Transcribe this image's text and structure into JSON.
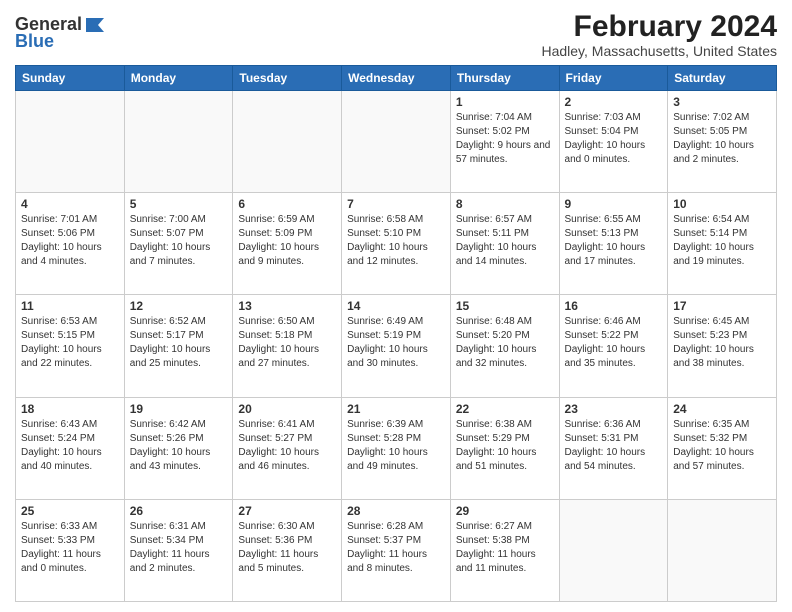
{
  "logo": {
    "general": "General",
    "blue": "Blue"
  },
  "title": "February 2024",
  "subtitle": "Hadley, Massachusetts, United States",
  "days_of_week": [
    "Sunday",
    "Monday",
    "Tuesday",
    "Wednesday",
    "Thursday",
    "Friday",
    "Saturday"
  ],
  "weeks": [
    [
      {
        "day": "",
        "sunrise": "",
        "sunset": "",
        "daylight": ""
      },
      {
        "day": "",
        "sunrise": "",
        "sunset": "",
        "daylight": ""
      },
      {
        "day": "",
        "sunrise": "",
        "sunset": "",
        "daylight": ""
      },
      {
        "day": "",
        "sunrise": "",
        "sunset": "",
        "daylight": ""
      },
      {
        "day": "1",
        "sunrise": "Sunrise: 7:04 AM",
        "sunset": "Sunset: 5:02 PM",
        "daylight": "Daylight: 9 hours and 57 minutes."
      },
      {
        "day": "2",
        "sunrise": "Sunrise: 7:03 AM",
        "sunset": "Sunset: 5:04 PM",
        "daylight": "Daylight: 10 hours and 0 minutes."
      },
      {
        "day": "3",
        "sunrise": "Sunrise: 7:02 AM",
        "sunset": "Sunset: 5:05 PM",
        "daylight": "Daylight: 10 hours and 2 minutes."
      }
    ],
    [
      {
        "day": "4",
        "sunrise": "Sunrise: 7:01 AM",
        "sunset": "Sunset: 5:06 PM",
        "daylight": "Daylight: 10 hours and 4 minutes."
      },
      {
        "day": "5",
        "sunrise": "Sunrise: 7:00 AM",
        "sunset": "Sunset: 5:07 PM",
        "daylight": "Daylight: 10 hours and 7 minutes."
      },
      {
        "day": "6",
        "sunrise": "Sunrise: 6:59 AM",
        "sunset": "Sunset: 5:09 PM",
        "daylight": "Daylight: 10 hours and 9 minutes."
      },
      {
        "day": "7",
        "sunrise": "Sunrise: 6:58 AM",
        "sunset": "Sunset: 5:10 PM",
        "daylight": "Daylight: 10 hours and 12 minutes."
      },
      {
        "day": "8",
        "sunrise": "Sunrise: 6:57 AM",
        "sunset": "Sunset: 5:11 PM",
        "daylight": "Daylight: 10 hours and 14 minutes."
      },
      {
        "day": "9",
        "sunrise": "Sunrise: 6:55 AM",
        "sunset": "Sunset: 5:13 PM",
        "daylight": "Daylight: 10 hours and 17 minutes."
      },
      {
        "day": "10",
        "sunrise": "Sunrise: 6:54 AM",
        "sunset": "Sunset: 5:14 PM",
        "daylight": "Daylight: 10 hours and 19 minutes."
      }
    ],
    [
      {
        "day": "11",
        "sunrise": "Sunrise: 6:53 AM",
        "sunset": "Sunset: 5:15 PM",
        "daylight": "Daylight: 10 hours and 22 minutes."
      },
      {
        "day": "12",
        "sunrise": "Sunrise: 6:52 AM",
        "sunset": "Sunset: 5:17 PM",
        "daylight": "Daylight: 10 hours and 25 minutes."
      },
      {
        "day": "13",
        "sunrise": "Sunrise: 6:50 AM",
        "sunset": "Sunset: 5:18 PM",
        "daylight": "Daylight: 10 hours and 27 minutes."
      },
      {
        "day": "14",
        "sunrise": "Sunrise: 6:49 AM",
        "sunset": "Sunset: 5:19 PM",
        "daylight": "Daylight: 10 hours and 30 minutes."
      },
      {
        "day": "15",
        "sunrise": "Sunrise: 6:48 AM",
        "sunset": "Sunset: 5:20 PM",
        "daylight": "Daylight: 10 hours and 32 minutes."
      },
      {
        "day": "16",
        "sunrise": "Sunrise: 6:46 AM",
        "sunset": "Sunset: 5:22 PM",
        "daylight": "Daylight: 10 hours and 35 minutes."
      },
      {
        "day": "17",
        "sunrise": "Sunrise: 6:45 AM",
        "sunset": "Sunset: 5:23 PM",
        "daylight": "Daylight: 10 hours and 38 minutes."
      }
    ],
    [
      {
        "day": "18",
        "sunrise": "Sunrise: 6:43 AM",
        "sunset": "Sunset: 5:24 PM",
        "daylight": "Daylight: 10 hours and 40 minutes."
      },
      {
        "day": "19",
        "sunrise": "Sunrise: 6:42 AM",
        "sunset": "Sunset: 5:26 PM",
        "daylight": "Daylight: 10 hours and 43 minutes."
      },
      {
        "day": "20",
        "sunrise": "Sunrise: 6:41 AM",
        "sunset": "Sunset: 5:27 PM",
        "daylight": "Daylight: 10 hours and 46 minutes."
      },
      {
        "day": "21",
        "sunrise": "Sunrise: 6:39 AM",
        "sunset": "Sunset: 5:28 PM",
        "daylight": "Daylight: 10 hours and 49 minutes."
      },
      {
        "day": "22",
        "sunrise": "Sunrise: 6:38 AM",
        "sunset": "Sunset: 5:29 PM",
        "daylight": "Daylight: 10 hours and 51 minutes."
      },
      {
        "day": "23",
        "sunrise": "Sunrise: 6:36 AM",
        "sunset": "Sunset: 5:31 PM",
        "daylight": "Daylight: 10 hours and 54 minutes."
      },
      {
        "day": "24",
        "sunrise": "Sunrise: 6:35 AM",
        "sunset": "Sunset: 5:32 PM",
        "daylight": "Daylight: 10 hours and 57 minutes."
      }
    ],
    [
      {
        "day": "25",
        "sunrise": "Sunrise: 6:33 AM",
        "sunset": "Sunset: 5:33 PM",
        "daylight": "Daylight: 11 hours and 0 minutes."
      },
      {
        "day": "26",
        "sunrise": "Sunrise: 6:31 AM",
        "sunset": "Sunset: 5:34 PM",
        "daylight": "Daylight: 11 hours and 2 minutes."
      },
      {
        "day": "27",
        "sunrise": "Sunrise: 6:30 AM",
        "sunset": "Sunset: 5:36 PM",
        "daylight": "Daylight: 11 hours and 5 minutes."
      },
      {
        "day": "28",
        "sunrise": "Sunrise: 6:28 AM",
        "sunset": "Sunset: 5:37 PM",
        "daylight": "Daylight: 11 hours and 8 minutes."
      },
      {
        "day": "29",
        "sunrise": "Sunrise: 6:27 AM",
        "sunset": "Sunset: 5:38 PM",
        "daylight": "Daylight: 11 hours and 11 minutes."
      },
      {
        "day": "",
        "sunrise": "",
        "sunset": "",
        "daylight": ""
      },
      {
        "day": "",
        "sunrise": "",
        "sunset": "",
        "daylight": ""
      }
    ]
  ]
}
